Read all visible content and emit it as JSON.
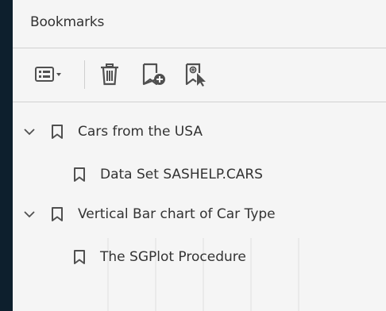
{
  "panel": {
    "title": "Bookmarks"
  },
  "toolbar": {
    "buttons": [
      {
        "name": "options-menu",
        "icon": "list-options-icon"
      },
      {
        "name": "delete-bookmark",
        "icon": "trash-icon"
      },
      {
        "name": "new-bookmark",
        "icon": "add-bookmark-icon"
      },
      {
        "name": "new-bookmark-from-structure",
        "icon": "bookmark-structure-icon"
      }
    ]
  },
  "tree": {
    "items": [
      {
        "label": "Cars from the USA",
        "expanded": true,
        "level": 0
      },
      {
        "label": "Data Set SASHELP.CARS",
        "level": 1
      },
      {
        "label": "Vertical Bar chart of Car Type",
        "expanded": true,
        "level": 0
      },
      {
        "label": "The SGPlot Procedure",
        "level": 1
      }
    ]
  },
  "colors": {
    "background": "#0d1f2d",
    "panel": "#f5f5f5",
    "text": "#333333",
    "icon": "#505050"
  }
}
